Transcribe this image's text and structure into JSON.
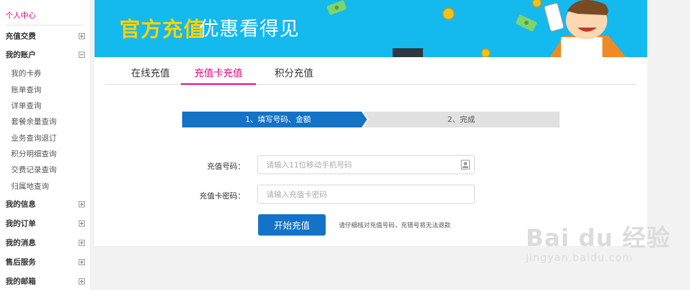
{
  "sidebar": {
    "title": "个人中心",
    "categories": [
      {
        "label": "充值交费",
        "toggle": "plus"
      },
      {
        "label": "我的账户",
        "toggle": "minus"
      },
      {
        "label": "我的信息",
        "toggle": "plus"
      },
      {
        "label": "我的订单",
        "toggle": "plus"
      },
      {
        "label": "我的消息",
        "toggle": "plus"
      },
      {
        "label": "售后服务",
        "toggle": "plus"
      },
      {
        "label": "我的邮箱",
        "toggle": "plus"
      }
    ],
    "account_items": [
      "我的卡券",
      "账单查询",
      "详单查询",
      "套餐余量查询",
      "业务查询退订",
      "积分明细查询",
      "交费记录查询",
      "归属地查询"
    ]
  },
  "banner": {
    "title": "官方充值",
    "subtitle": "优惠看得见"
  },
  "tabs": [
    {
      "label": "在线充值",
      "active": false
    },
    {
      "label": "充值卡充值",
      "active": true
    },
    {
      "label": "积分充值",
      "active": false
    }
  ],
  "steps": [
    "1、填写号码、金额",
    "2、完成"
  ],
  "form": {
    "phone_label": "充值号码：",
    "phone_placeholder": "请输入11位移动手机号码",
    "card_pw_label": "充值卡密码：",
    "card_pw_placeholder": "请输入充值卡密码",
    "submit_label": "开始充值",
    "hint": "请仔细核对充值号码，充错号将无法退款"
  },
  "watermark": {
    "main": "Bai du 经验",
    "url": "jingyan.baidu.com"
  },
  "colors": {
    "accent_pink": "#e4007f",
    "primary_blue": "#1473c6",
    "banner_blue": "#14b9ee",
    "banner_yellow": "#ffd200"
  }
}
